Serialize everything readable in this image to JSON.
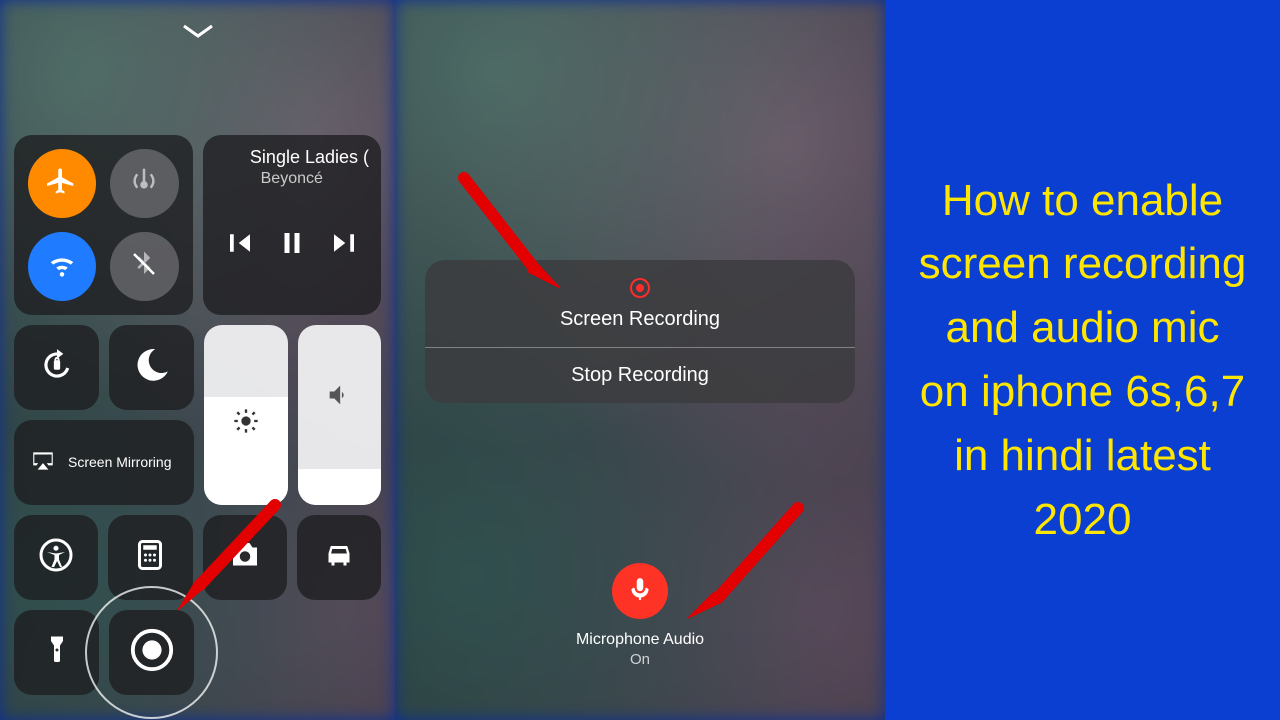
{
  "left": {
    "music": {
      "title": "Single Ladies (",
      "artist": "Beyoncé"
    },
    "mirror_label": "Screen Mirroring"
  },
  "mid": {
    "sheet_title": "Screen Recording",
    "sheet_action": "Stop Recording",
    "mic_label": "Microphone Audio",
    "mic_state": "On"
  },
  "right": {
    "headline": "How to enable screen recording and audio mic on iphone 6s,6,7 in hindi latest 2020"
  },
  "colors": {
    "accent_blue": "#0b3fd1",
    "accent_yellow": "#ffe600",
    "arrow": "#e20000"
  }
}
